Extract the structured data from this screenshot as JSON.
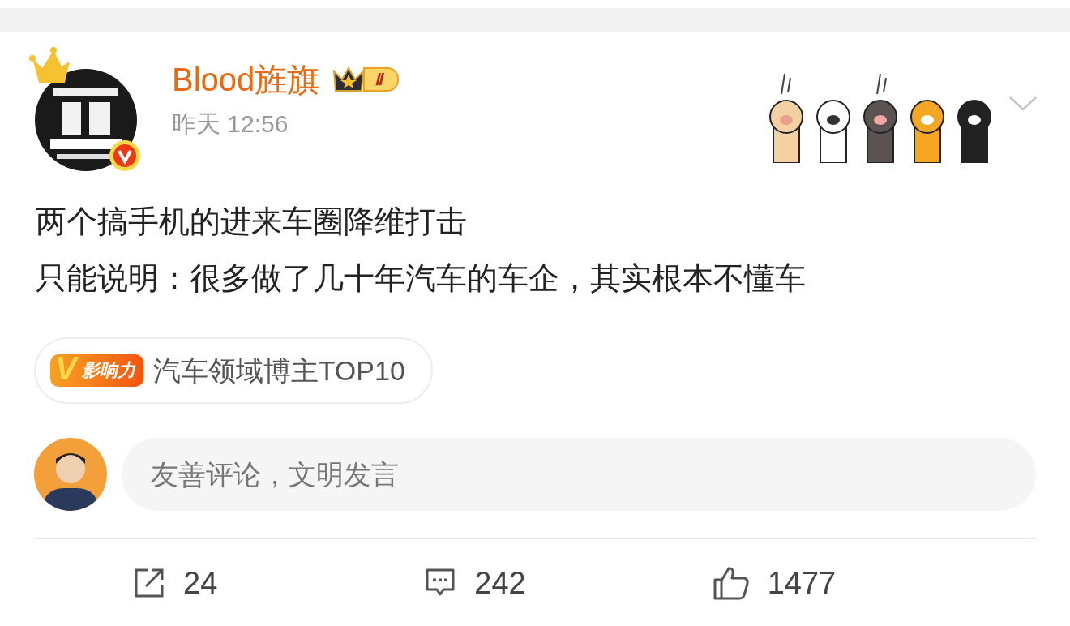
{
  "post": {
    "author": "Blood旌旗",
    "level_badge": "Ⅱ",
    "time": "昨天 12:56",
    "verified": true,
    "lines": [
      "两个搞手机的进来车圈降维打击",
      "只能说明：很多做了几十年汽车的车企，其实根本不懂车"
    ],
    "tag": {
      "mark": "V",
      "badge": "影响力",
      "text": "汽车领域博主TOP10"
    }
  },
  "comment_box": {
    "placeholder": "友善评论，文明发言"
  },
  "actions": [
    {
      "kind": "repost",
      "count": "24"
    },
    {
      "kind": "comment",
      "count": "242"
    },
    {
      "kind": "like",
      "count": "1477"
    }
  ]
}
